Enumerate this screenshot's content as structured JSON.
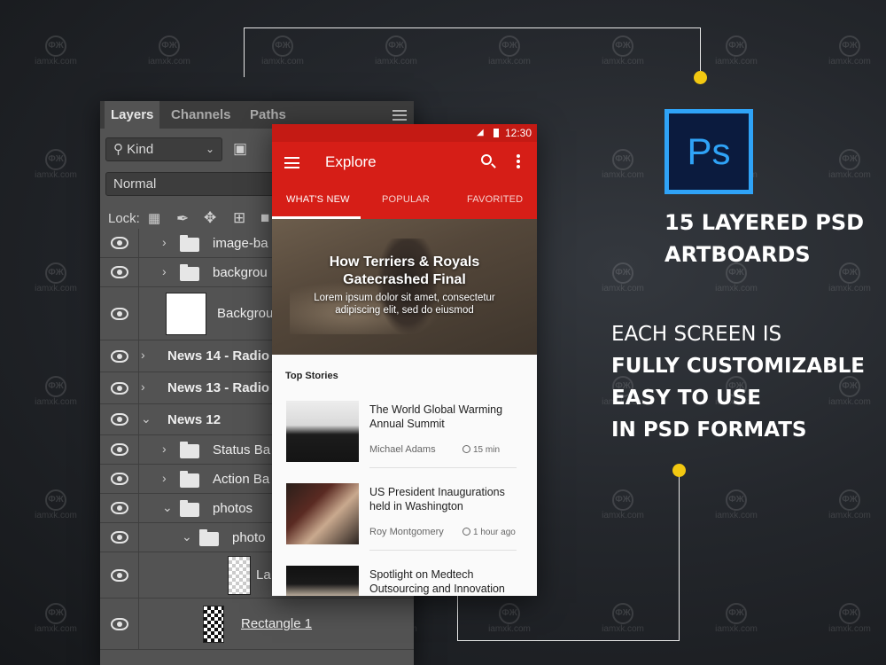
{
  "watermark": {
    "mark": "ФЖ",
    "text": "iamxk.com"
  },
  "layers_panel": {
    "tabs": [
      "Layers",
      "Channels",
      "Paths"
    ],
    "filter_label": "Kind",
    "blend_mode": "Normal",
    "lock_label": "Lock:",
    "rows": [
      {
        "label": "image-ba",
        "type": "folder",
        "bold": false
      },
      {
        "label": "backgrou",
        "type": "folder",
        "bold": false
      },
      {
        "label": "Backgrou",
        "type": "thumb",
        "bold": false
      },
      {
        "label": "News 14 - Radio",
        "type": "group",
        "bold": true
      },
      {
        "label": "News 13 - Radio",
        "type": "group",
        "bold": true
      },
      {
        "label": "News 12",
        "type": "group-open",
        "bold": true
      },
      {
        "label": "Status Ba",
        "type": "folder",
        "bold": false
      },
      {
        "label": "Action Ba",
        "type": "folder",
        "bold": false
      },
      {
        "label": "photos",
        "type": "folder-open",
        "bold": false
      },
      {
        "label": "photo",
        "type": "folder-open",
        "bold": false
      },
      {
        "label": "La",
        "type": "thumb-checker",
        "bold": false
      },
      {
        "label": "Rectangle 1",
        "type": "thumb-shape",
        "bold": false
      }
    ]
  },
  "phone": {
    "status_time": "12:30",
    "title": "Explore",
    "tabs": [
      "WHAT'S NEW",
      "POPULAR",
      "FAVORITED"
    ],
    "hero": {
      "title_line1": "How Terriers & Royals",
      "title_line2": "Gatecrashed Final",
      "sub_line1": "Lorem ipsum dolor sit amet, consectetur",
      "sub_line2": "adipiscing elit, sed do eiusmod"
    },
    "section_title": "Top Stories",
    "stories": [
      {
        "title": "The World Global Warming Annual Summit",
        "author": "Michael Adams",
        "time": "15 min"
      },
      {
        "title": "US President Inaugurations held in Washington",
        "author": "Roy Montgomery",
        "time": "1 hour ago"
      },
      {
        "title": "Spotlight on Medtech Outsourcing and Innovation",
        "author": "",
        "time": ""
      }
    ]
  },
  "promo": {
    "logo_text": "Ps",
    "headline_line1": "15 LAYERED PSD",
    "headline_line2": "ARTBOARDS",
    "feature_intro": "EACH SCREEN IS",
    "features": [
      "FULLY CUSTOMIZABLE",
      "EASY TO USE",
      "IN PSD FORMATS"
    ]
  },
  "colors": {
    "accent_red": "#d61e17",
    "ps_blue": "#2fa3f7",
    "connector_dot": "#f2c811"
  }
}
